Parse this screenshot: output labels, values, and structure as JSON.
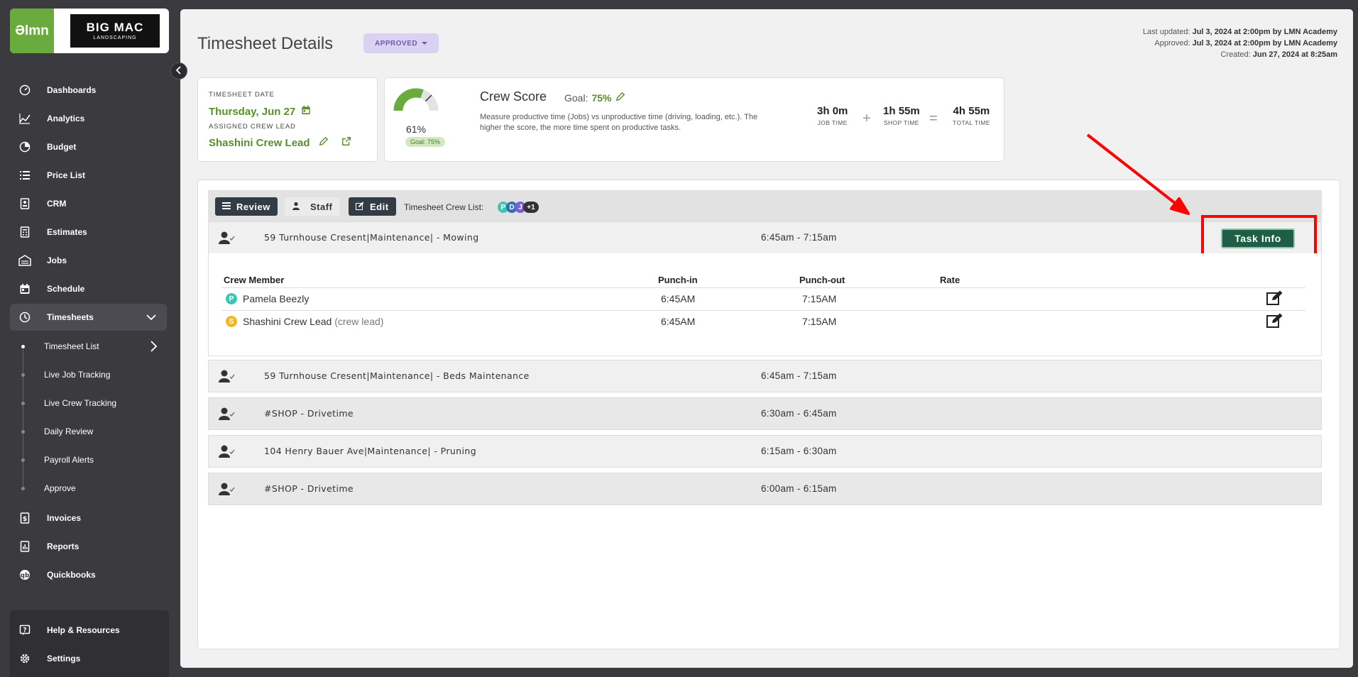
{
  "brand": {
    "lmn": "Əlmn",
    "bigmac_big": "BIG MAC",
    "bigmac_sub": "LANDSCAPING"
  },
  "nav": {
    "items": [
      {
        "label": "Dashboards",
        "icon": "dashboard-icon"
      },
      {
        "label": "Analytics",
        "icon": "analytics-icon"
      },
      {
        "label": "Budget",
        "icon": "budget-icon"
      },
      {
        "label": "Price List",
        "icon": "list-icon"
      },
      {
        "label": "CRM",
        "icon": "crm-icon"
      },
      {
        "label": "Estimates",
        "icon": "estimates-icon"
      },
      {
        "label": "Jobs",
        "icon": "jobs-icon"
      },
      {
        "label": "Schedule",
        "icon": "calendar-icon"
      },
      {
        "label": "Timesheets",
        "icon": "clock-icon"
      },
      {
        "label": "Invoices",
        "icon": "invoice-icon"
      },
      {
        "label": "Reports",
        "icon": "reports-icon"
      },
      {
        "label": "Quickbooks",
        "icon": "quickbooks-icon"
      }
    ],
    "sub_items": [
      "Timesheet List",
      "Live Job Tracking",
      "Live Crew Tracking",
      "Daily Review",
      "Payroll Alerts",
      "Approve"
    ],
    "bottom": [
      {
        "label": "Help & Resources",
        "icon": "help-icon"
      },
      {
        "label": "Settings",
        "icon": "gear-icon"
      }
    ]
  },
  "header": {
    "title": "Timesheet Details",
    "status": "APPROVED",
    "last_updated_label": "Last updated:",
    "last_updated": "Jul 3, 2024 at 2:00pm by LMN Academy",
    "approved_label": "Approved:",
    "approved": "Jul 3, 2024 at 2:00pm by LMN Academy",
    "created_label": "Created:",
    "created": "Jun 27, 2024 at 8:25am"
  },
  "date_card": {
    "date_label": "TIMESHEET DATE",
    "date": "Thursday, Jun 27",
    "lead_label": "ASSIGNED CREW LEAD",
    "lead": "Shashini Crew Lead"
  },
  "crew_score": {
    "percent": "61%",
    "score_value": 61,
    "goal_badge": "Goal: 75%",
    "title": "Crew Score",
    "goal_label": "Goal:",
    "goal": "75%",
    "description": "Measure productive time (Jobs) vs unproductive time (driving, loading, etc.). The higher the score, the more time spent on productive tasks.",
    "job_time_h": "3h",
    "job_time_m": "0m",
    "job_time_label": "JOB TIME",
    "shop_time_h": "1h",
    "shop_time_m": "55m",
    "shop_time_label": "SHOP TIME",
    "total_time_h": "4h",
    "total_time_m": "55m",
    "total_time_label": "TOTAL TIME",
    "plus": "+",
    "equals": "="
  },
  "toolbar": {
    "review": "Review",
    "staff": "Staff",
    "edit": "Edit",
    "crew_list_label": "Timesheet Crew List:",
    "chips": [
      {
        "text": "P",
        "color": "#3cc6b4"
      },
      {
        "text": "D",
        "color": "#2f6fb5"
      },
      {
        "text": "J",
        "color": "#7a5fd0"
      },
      {
        "text": "+1",
        "color": "#333333"
      }
    ]
  },
  "tasks": [
    {
      "name": "59 Turnhouse Cresent|Maintenance| - Mowing",
      "time": "6:45am - 7:15am"
    },
    {
      "name": "59 Turnhouse Cresent|Maintenance| - Beds Maintenance",
      "time": "6:45am - 7:15am"
    },
    {
      "name": "#SHOP - Drivetime",
      "time": "6:30am - 6:45am"
    },
    {
      "name": "104 Henry Bauer Ave|Maintenance| - Pruning",
      "time": "6:15am - 6:30am"
    },
    {
      "name": "#SHOP - Drivetime",
      "time": "6:00am - 6:15am"
    }
  ],
  "task_info_label": "Task Info",
  "crew_table": {
    "headers": [
      "Crew Member",
      "Punch-in",
      "Punch-out",
      "Rate"
    ],
    "rows": [
      {
        "initial": "P",
        "color": "#3cc6b4",
        "name": "Pamela Beezly",
        "suffix": "",
        "in": "6:45AM",
        "out": "7:15AM"
      },
      {
        "initial": "S",
        "color": "#f2b824",
        "name": "Shashini Crew Lead",
        "suffix": "(crew lead)",
        "in": "6:45AM",
        "out": "7:15AM"
      }
    ]
  }
}
